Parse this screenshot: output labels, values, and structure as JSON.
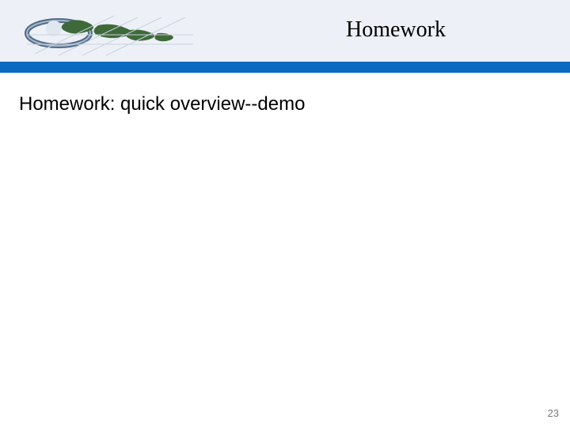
{
  "header": {
    "title": "Homework"
  },
  "body": {
    "heading": "Homework: quick overview--demo"
  },
  "footer": {
    "page_number": "23"
  }
}
